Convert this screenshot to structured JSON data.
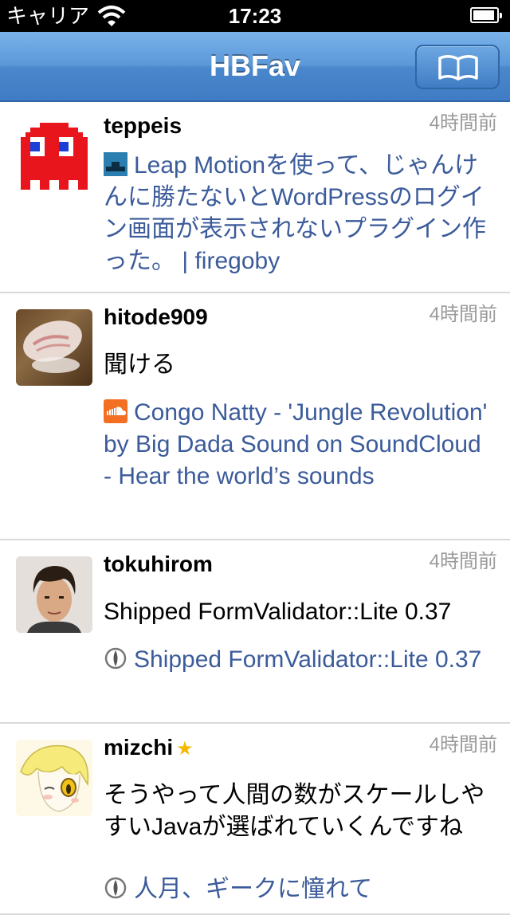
{
  "status_bar": {
    "carrier": "キャリア",
    "time": "17:23",
    "battery_level": 0.92
  },
  "nav": {
    "title": "HBFav",
    "bookmark_icon": "open-book-icon"
  },
  "entries": [
    {
      "user": "teppeis",
      "time": "4時間前",
      "starred": false,
      "comment": "",
      "link_title": "Leap Motionを使って、じゃんけんに勝たないとWordPressのログイン画面が表示されないプラグイン作った。 | firegoby",
      "favicon": "site-favicon-icon"
    },
    {
      "user": "hitode909",
      "time": "4時間前",
      "starred": false,
      "comment": "聞ける",
      "link_title": "Congo Natty - 'Jungle Revolution' by Big Dada Sound on SoundCloud - Hear the world’s sounds",
      "favicon": "soundcloud-icon"
    },
    {
      "user": "tokuhirom",
      "time": "4時間前",
      "starred": false,
      "comment": "Shipped FormValidator::Lite 0.37",
      "link_title": "Shipped FormValidator::Lite 0.37",
      "favicon": "globe-icon"
    },
    {
      "user": "mizchi",
      "time": "4時間前",
      "starred": true,
      "star": "★",
      "comment": "そうやって人間の数がスケールしやすいJavaが選ばれていくんですね",
      "link_title": "人月、ギークに憧れて",
      "favicon": "globe-icon"
    }
  ]
}
